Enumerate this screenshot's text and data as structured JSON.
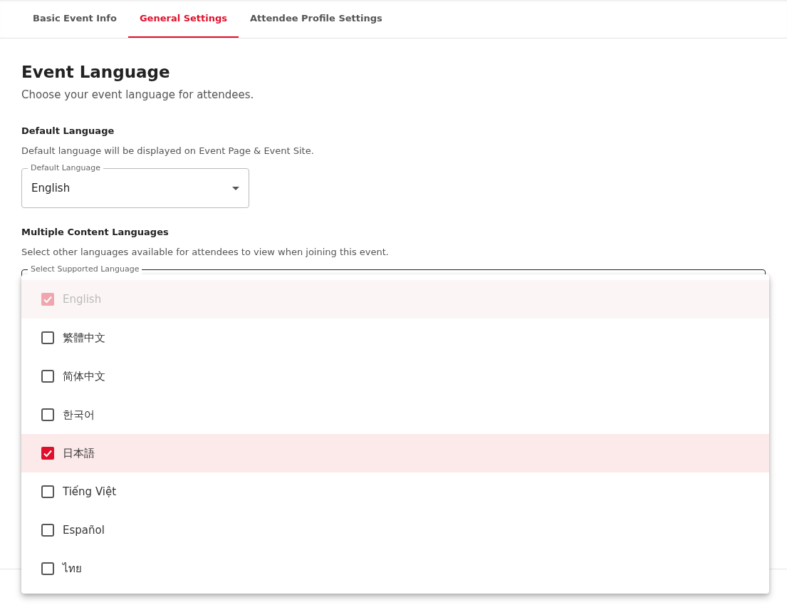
{
  "tabs": [
    {
      "label": "Basic Event Info",
      "selected": false
    },
    {
      "label": "General Settings",
      "selected": true
    },
    {
      "label": "Attendee Profile Settings",
      "selected": false
    }
  ],
  "section": {
    "title": "Event Language",
    "subtitle": "Choose your event language for attendees."
  },
  "default_language": {
    "heading": "Default Language",
    "description": "Default language will be displayed on Event Page & Event Site.",
    "field_label": "Default Language",
    "value": "English"
  },
  "content_languages": {
    "heading": "Multiple Content Languages",
    "description": "Select other languages available for attendees to view when joining this event.",
    "field_label": "Select Supported Language"
  },
  "language_menu": [
    {
      "label": "English",
      "checked": true,
      "disabled": true
    },
    {
      "label": "繁體中文",
      "checked": false,
      "disabled": false
    },
    {
      "label": "简体中文",
      "checked": false,
      "disabled": false
    },
    {
      "label": "한국어",
      "checked": false,
      "disabled": false
    },
    {
      "label": "日本語",
      "checked": true,
      "disabled": false
    },
    {
      "label": "Tiếng Việt",
      "checked": false,
      "disabled": false
    },
    {
      "label": "Español",
      "checked": false,
      "disabled": false
    },
    {
      "label": "ไทย",
      "checked": false,
      "disabled": false
    }
  ]
}
